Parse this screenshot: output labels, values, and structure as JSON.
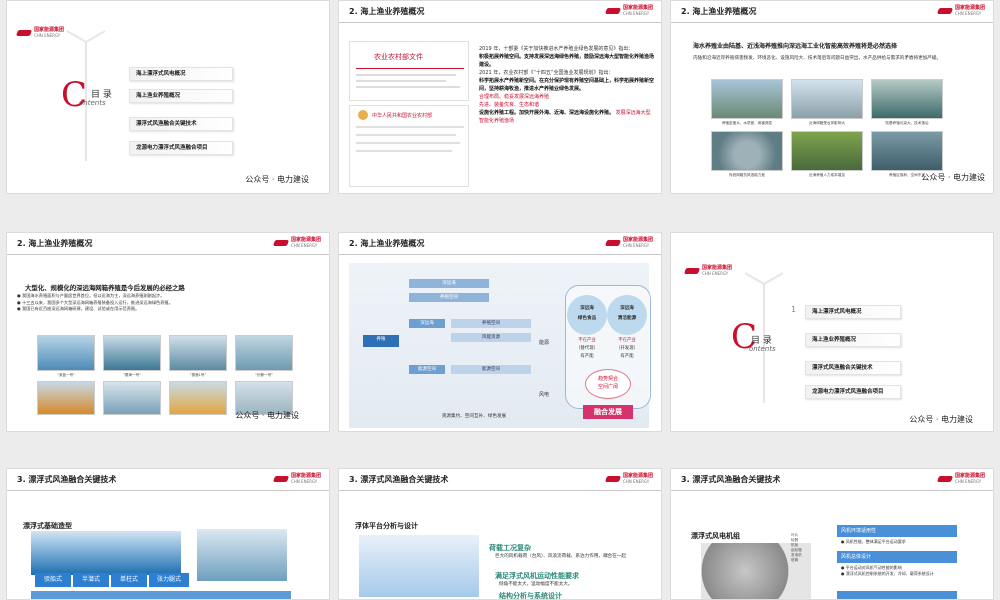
{
  "brand": {
    "name": "国家能源集团",
    "en": "CHN ENERGY",
    "color": "#c8102e"
  },
  "footer": "公众号 · 电力建设",
  "contents": {
    "cn": "目 录",
    "en": "ontents",
    "letter": "C",
    "items": [
      "海上漂浮式风电概况",
      "海上渔业养殖概况",
      "漂浮式风渔融合关键技术",
      "龙源电力漂浮式风渔融合项目"
    ]
  },
  "slide2": {
    "title": "2. 海上渔业养殖概况",
    "doc_title": "农业农村部文件",
    "doc_header": "中华人民共和国农业农村部",
    "paragraphs": [
      "2019 年，十部委《关于加快推进水产养殖业绿色发展的意见》指出：",
      "积极拓展养殖空间。支持发展深远海绿色养殖，鼓励深远海大型智能化养殖渔场建设。",
      "2021 年，农业农村部《“十四五”全国渔业发展规划》指出：",
      "科学拓展水产养殖新空间。在充分保护现有养殖空间基础上，科学拓展养殖新空间，坚持耕海牧渔，推进水产养殖业绿色发展。",
      "设施化养殖工程。加快开展外海、近海、深远海设施化养殖。"
    ],
    "highlights": [
      "合理布局、稳妥发展深远海养殖",
      "推进深远海养殖业规模化",
      "先进、装备优良、生态和谐",
      "发展深远海大型智能化养殖渔场"
    ]
  },
  "slide3": {
    "title": "2. 海上渔业养殖概况",
    "heading": "海水养殖业由陆基、近浅海养殖推向深远海工业化智能高效养殖将是必然选择",
    "intro": "内陆和沿海近岸养殖病害频发、环境恶化、设施风险大、技术落后等问题日益突出，水产品供给与需求的矛盾将更加严峻。",
    "captions": [
      "养殖密度大、水质差、病害频发",
      "近海网箱受台风影响大",
      "养殖区饱和，空间不足",
      "传统网箱抗风浪能力差",
      "近海养殖人力成本增加",
      "陆基养殖污染大、技术落后"
    ]
  },
  "slide4": {
    "title": "2. 海上渔业养殖概况",
    "heading": "大型化、规模化的深远海网箱养殖是今后发展的必经之路",
    "bullets": [
      "我国海水养殖面积与产量居世界首位，但以近海为主，深远海养殖刚刚起步。",
      "十三五以来，我国多个大型深远海网箱养殖装备投入运行，推进深远海绿色养殖。",
      "我国已有近百座深远海网箱研建，建设、试验或在用示范养殖。"
    ],
    "captions": [
      "“深蓝一号”",
      "“德海一号”",
      "“振渔1号”",
      "“长鲸一号”",
      "“海峡一号”",
      "“国信1号”",
      "“深蓝2号”",
      "“经海001号”"
    ]
  },
  "slide5": {
    "title": "2. 海上渔业养殖概况",
    "left_labels": [
      "养殖",
      "能源"
    ],
    "mid": [
      "深远海",
      "养殖空间",
      "能源空间",
      "风能资源"
    ],
    "right_a": [
      "深远海",
      "绿色食品",
      "不在产业",
      "（替代现）",
      "有产能"
    ],
    "right_b": [
      "深远海",
      "清洁能源",
      "不在产业",
      "（开发现）",
      "有产能"
    ],
    "result1": "趋势契合",
    "result2": "空间广阔",
    "result3": "融合发展",
    "bottom": "资源集约、空间互补、绿色发展",
    "wind": "风电"
  },
  "slide6": {},
  "slide7": {
    "title": "3. 漂浮式风渔融合关键技术",
    "subtitle": "漂浮式基础造型",
    "tags": [
      "驳船式",
      "半潜式",
      "单柱式",
      "张力腿式"
    ]
  },
  "slide8": {
    "title": "3. 漂浮式风渔融合关键技术",
    "subtitle": "浮体平台分析与设计",
    "point1": "荷载工况复杂",
    "point1_desc": "巨大的风机载荷（台风）、风浪流荷载、系泊力作用，耦合在一起",
    "point2": "满足浮式风机运动性能要求",
    "point2_desc": "倾角不能太大，运动幅度不能太大。",
    "point3": "结构分析与系统设计"
  },
  "slide9": {
    "title": "3. 漂浮式风渔融合关键技术",
    "subtitle": "漂浮式风电机组",
    "cards": [
      "风机环境适用性",
      "风机总体设计"
    ],
    "card_items": [
      "风机性能，整体满足平台运动要求",
      "平台运动对风机气动性能的影响",
      "漂浮式风机控制系统的开发、冷却、载荷系统设计"
    ],
    "labels": [
      "叶片",
      "轮毂",
      "机舱",
      "齿轮箱",
      "发电机",
      "塔筒",
      "变流器"
    ]
  }
}
